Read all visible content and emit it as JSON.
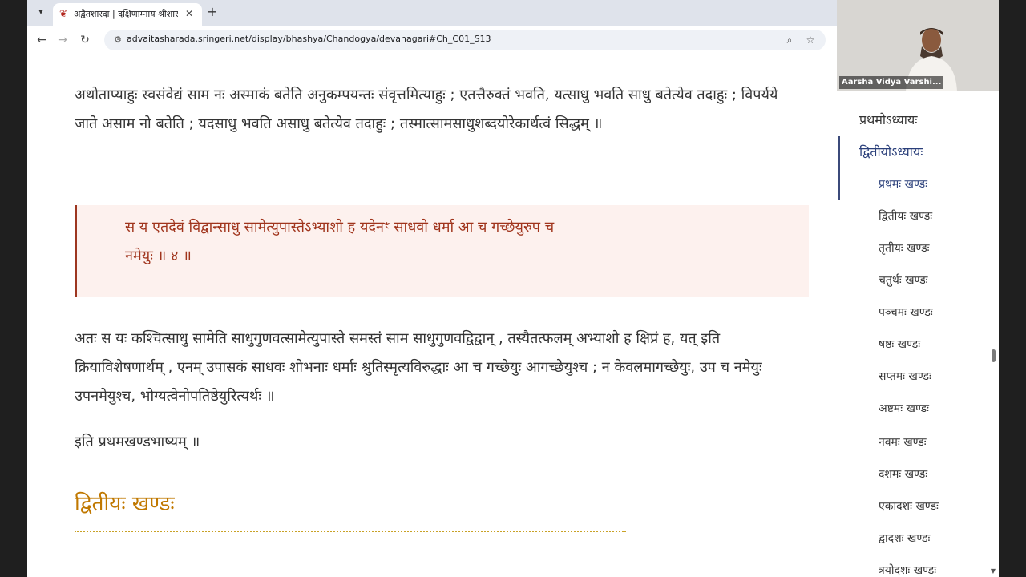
{
  "browser": {
    "tab_title": "अद्वैतशारदा | दक्षिणाम्नाय श्रीशारदापीठम्",
    "url": "advaitasharada.sringeri.net/display/bhashya/Chandogya/devanagari#Ch_C01_S13"
  },
  "content": {
    "para1": "अथोताप्याहुः स्वसंवेद्यं साम नः अस्माकं बतेति अनुकम्पयन्तः संवृत्तमित्याहुः ; एतत्तैरुक्तं भवति, यत्साधु भवति साधु बतेत्येव तदाहुः ; विपर्यये जाते असाम नो बतेति ; यदसाधु भवति असाधु बतेत्येव तदाहुः ; तस्मात्सामसाधुशब्दयोरेकार्थत्वं सिद्धम् ॥",
    "quote": "स य एतदेवं विद्वान्साधु सामेत्युपास्तेऽभ्याशो ह यदेनꣳ साधवो धर्मा आ च गच्छेयुरुप च नमेयुः ॥ ४ ॥",
    "para2": "अतः स यः कश्चित्साधु सामेति साधुगुणवत्सामेत्युपास्ते समस्तं साम साधुगुणवद्विद्वान् , तस्यैतत्फलम् अभ्याशो ह क्षिप्रं ह, यत् इति क्रियाविशेषणार्थम् , एनम् उपासकं साधवः शोभनाः धर्माः श्रुतिस्मृत्यविरुद्धाः आ च गच्छेयुः आगच्छेयुश्च ; न केवलमागच्छेयुः, उप च नमेयुः उपनमेयुश्च, भोग्यत्वेनोपतिष्ठेयुरित्यर्थः ॥",
    "para3": "इति प्रथमखण्डभाष्यम् ॥",
    "section_heading": "द्वितीयः खण्डः"
  },
  "sidebar": {
    "chapters": [
      "प्रथमोऽध्यायः",
      "द्वितीयोऽध्यायः"
    ],
    "sections": [
      "प्रथमः खण्डः",
      "द्वितीयः खण्डः",
      "तृतीयः खण्डः",
      "चतुर्थः खण्डः",
      "पञ्चमः खण्डः",
      "षष्ठः खण्डः",
      "सप्तमः खण्डः",
      "अष्टमः खण्डः",
      "नवमः खण्डः",
      "दशमः खण्डः",
      "एकादशः खण्डः",
      "द्वादशः खण्डः",
      "त्रयोदशः खण्डः"
    ]
  },
  "video": {
    "caption": "Aarsha Vidya Varshi..."
  }
}
